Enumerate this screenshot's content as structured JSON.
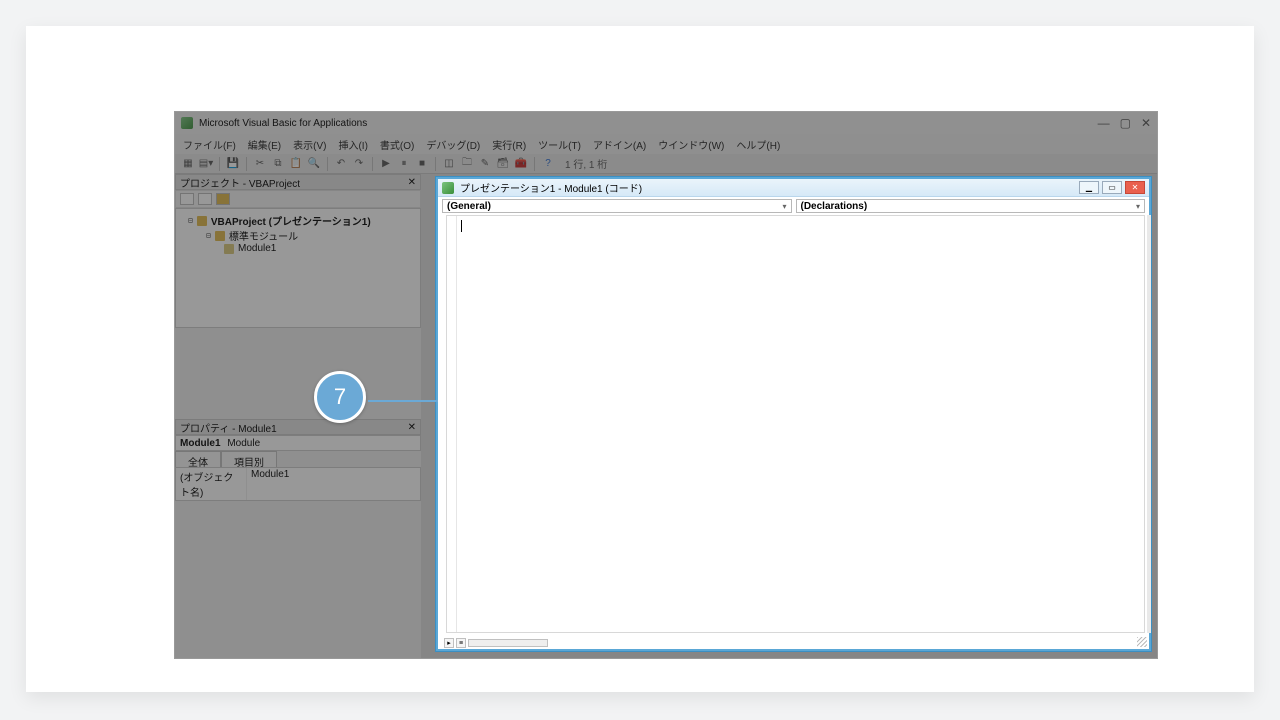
{
  "window": {
    "title": "Microsoft Visual Basic for Applications",
    "controls": {
      "min": "—",
      "max": "▢",
      "close": "✕"
    }
  },
  "menu": {
    "items": [
      "ファイル(F)",
      "編集(E)",
      "表示(V)",
      "挿入(I)",
      "書式(O)",
      "デバッグ(D)",
      "実行(R)",
      "ツール(T)",
      "アドイン(A)",
      "ウインドウ(W)",
      "ヘルプ(H)"
    ]
  },
  "toolbar": {
    "lineinfo": "1 行, 1 桁"
  },
  "project_pane": {
    "title": "プロジェクト - VBAProject",
    "tree": {
      "root": "VBAProject (プレゼンテーション1)",
      "modules_folder": "標準モジュール",
      "module_item": "Module1"
    }
  },
  "properties_pane": {
    "title": "プロパティ - Module1",
    "object_label": "Module1",
    "object_type": "Module",
    "tabs": {
      "all": "全体",
      "bycat": "項目別"
    },
    "rows": {
      "name_key": "(オブジェクト名)",
      "name_val": "Module1"
    }
  },
  "code_window": {
    "title": "プレゼンテーション1 - Module1 (コード)",
    "dropdowns": {
      "object": "(General)",
      "proc": "(Declarations)"
    }
  },
  "annotation": {
    "number": "7"
  }
}
